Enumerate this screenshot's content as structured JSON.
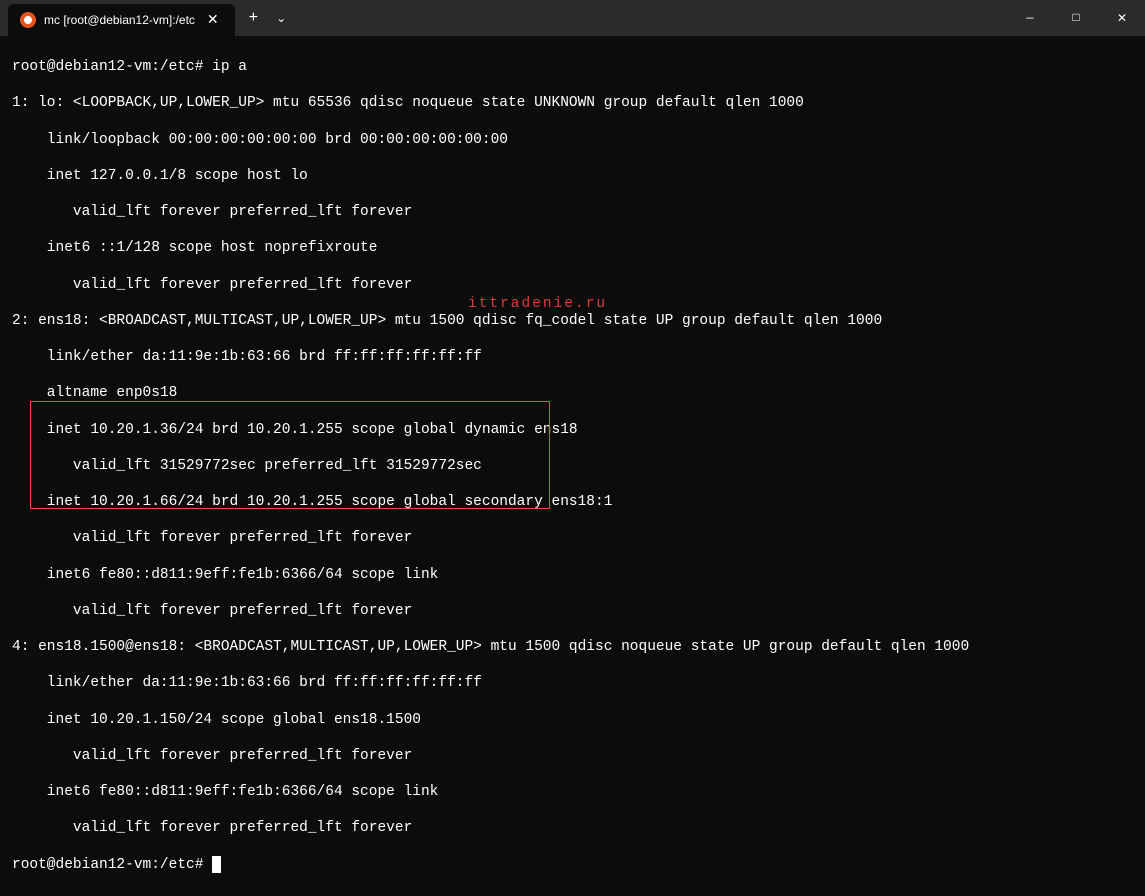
{
  "titlebar": {
    "tab_title": "mc [root@debian12-vm]:/etc",
    "tab_close": "✕",
    "new_tab": "+",
    "dropdown": "⌄",
    "minimize": "—",
    "maximize": "□",
    "close": "✕"
  },
  "terminal": {
    "prompt1": "root@debian12-vm:/etc# ip a",
    "lo_header": "1: lo: <LOOPBACK,UP,LOWER_UP> mtu 65536 qdisc noqueue state UNKNOWN group default qlen 1000",
    "lo_link": "    link/loopback 00:00:00:00:00:00 brd 00:00:00:00:00:00",
    "lo_inet": "    inet 127.0.0.1/8 scope host lo",
    "lo_valid": "       valid_lft forever preferred_lft forever",
    "lo_inet6": "    inet6 ::1/128 scope host noprefixroute",
    "lo_valid6": "       valid_lft forever preferred_lft forever",
    "ens18_header": "2: ens18: <BROADCAST,MULTICAST,UP,LOWER_UP> mtu 1500 qdisc fq_codel state UP group default qlen 1000",
    "ens18_link": "    link/ether da:11:9e:1b:63:66 brd ff:ff:ff:ff:ff:ff",
    "ens18_alt": "    altname enp0s18",
    "ens18_inet1": "    inet 10.20.1.36/24 brd 10.20.1.255 scope global dynamic ens18",
    "ens18_valid1": "       valid_lft 31529772sec preferred_lft 31529772sec",
    "ens18_inet2": "    inet 10.20.1.66/24 brd 10.20.1.255 scope global secondary ens18:1",
    "ens18_valid2": "       valid_lft forever preferred_lft forever",
    "ens18_inet6": "    inet6 fe80::d811:9eff:fe1b:6366/64 scope link",
    "ens18_valid6": "       valid_lft forever preferred_lft forever",
    "vlan_header": "4: ens18.1500@ens18: <BROADCAST,MULTICAST,UP,LOWER_UP> mtu 1500 qdisc noqueue state UP group default qlen 1000",
    "vlan_link": "    link/ether da:11:9e:1b:63:66 brd ff:ff:ff:ff:ff:ff",
    "vlan_inet": "    inet 10.20.1.150/24 scope global ens18.1500",
    "vlan_valid": "       valid_lft forever preferred_lft forever",
    "vlan_inet6": "    inet6 fe80::d811:9eff:fe1b:6366/64 scope link",
    "vlan_valid6": "       valid_lft forever preferred_lft forever",
    "prompt2": "root@debian12-vm:/etc# "
  },
  "watermark": "ittradenie.ru"
}
